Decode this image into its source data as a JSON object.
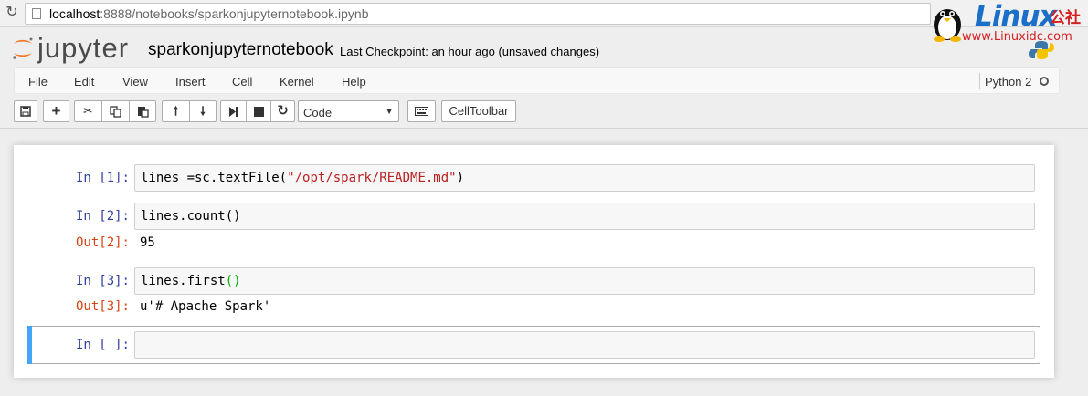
{
  "browser": {
    "url_host": "localhost",
    "url_path": ":8888/notebooks/sparkonjupyternotebook.ipynb",
    "reload_icon": "reload-icon"
  },
  "watermark": {
    "brand": "Linux",
    "brand_cn": "公社",
    "url": "www.Linuxidc.com"
  },
  "header": {
    "logo_text": "jupyter",
    "notebook_name": "sparkonjupyternotebook",
    "checkpoint": "Last Checkpoint: an hour ago (unsaved changes)"
  },
  "menu": {
    "items": [
      "File",
      "Edit",
      "View",
      "Insert",
      "Cell",
      "Kernel",
      "Help"
    ],
    "kernel_name": "Python 2"
  },
  "toolbar": {
    "cell_type": "Code",
    "celltoolbar_label": "CellToolbar",
    "icons": [
      "save-icon",
      "plus-icon",
      "cut-icon",
      "copy-icon",
      "paste-icon",
      "arrow-up-icon",
      "arrow-down-icon",
      "step-forward-icon",
      "stop-icon",
      "restart-icon",
      "keyboard-icon"
    ]
  },
  "cells": [
    {
      "in_prompt": "In [1]:",
      "code_plain": "lines =sc.textFile(",
      "code_string": "\"/opt/spark/README.md\"",
      "code_tail": ")"
    },
    {
      "in_prompt": "In [2]:",
      "code": "lines.count()",
      "out_prompt": "Out[2]:",
      "output": "95"
    },
    {
      "in_prompt": "In [3]:",
      "code_plain": "lines.first",
      "code_paren": "()",
      "out_prompt": "Out[3]:",
      "output": "u'# Apache Spark'"
    },
    {
      "in_prompt": "In [ ]:",
      "code": ""
    }
  ]
}
